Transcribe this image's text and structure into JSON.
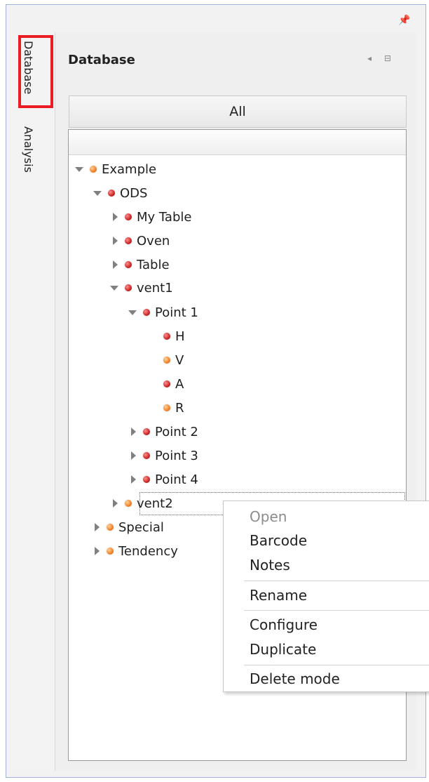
{
  "side_tabs": {
    "database": "Database",
    "analysis": "Analysis"
  },
  "panel": {
    "title": "Database",
    "filter_button": "All"
  },
  "tree": [
    {
      "label": "Example",
      "expanded": true,
      "color": "orange"
    },
    {
      "label": "ODS",
      "expanded": true,
      "color": "red"
    },
    {
      "label": "My Table",
      "expanded": false,
      "color": "red"
    },
    {
      "label": "Oven",
      "expanded": false,
      "color": "red"
    },
    {
      "label": "Table",
      "expanded": false,
      "color": "red"
    },
    {
      "label": "vent1",
      "expanded": true,
      "color": "red"
    },
    {
      "label": "Point 1",
      "expanded": true,
      "color": "red"
    },
    {
      "label": "H",
      "color": "red"
    },
    {
      "label": "V",
      "color": "orange"
    },
    {
      "label": "A",
      "color": "red"
    },
    {
      "label": "R",
      "color": "orange"
    },
    {
      "label": "Point 2",
      "expanded": false,
      "color": "red"
    },
    {
      "label": "Point 3",
      "expanded": false,
      "color": "red"
    },
    {
      "label": "Point 4",
      "expanded": false,
      "color": "red"
    },
    {
      "label": "vent2",
      "expanded": false,
      "color": "orange"
    },
    {
      "label": "Special",
      "expanded": false,
      "color": "orange"
    },
    {
      "label": "Tendency",
      "expanded": false,
      "color": "orange"
    }
  ],
  "context_menu": {
    "open": "Open",
    "barcode": "Barcode",
    "notes": "Notes",
    "rename": "Rename",
    "configure": "Configure",
    "duplicate": "Duplicate",
    "delete_mode": "Delete mode"
  },
  "colors": {
    "red_node": "#c51e1e",
    "orange_node": "#f07a1f",
    "highlight": "#ea1d24"
  }
}
